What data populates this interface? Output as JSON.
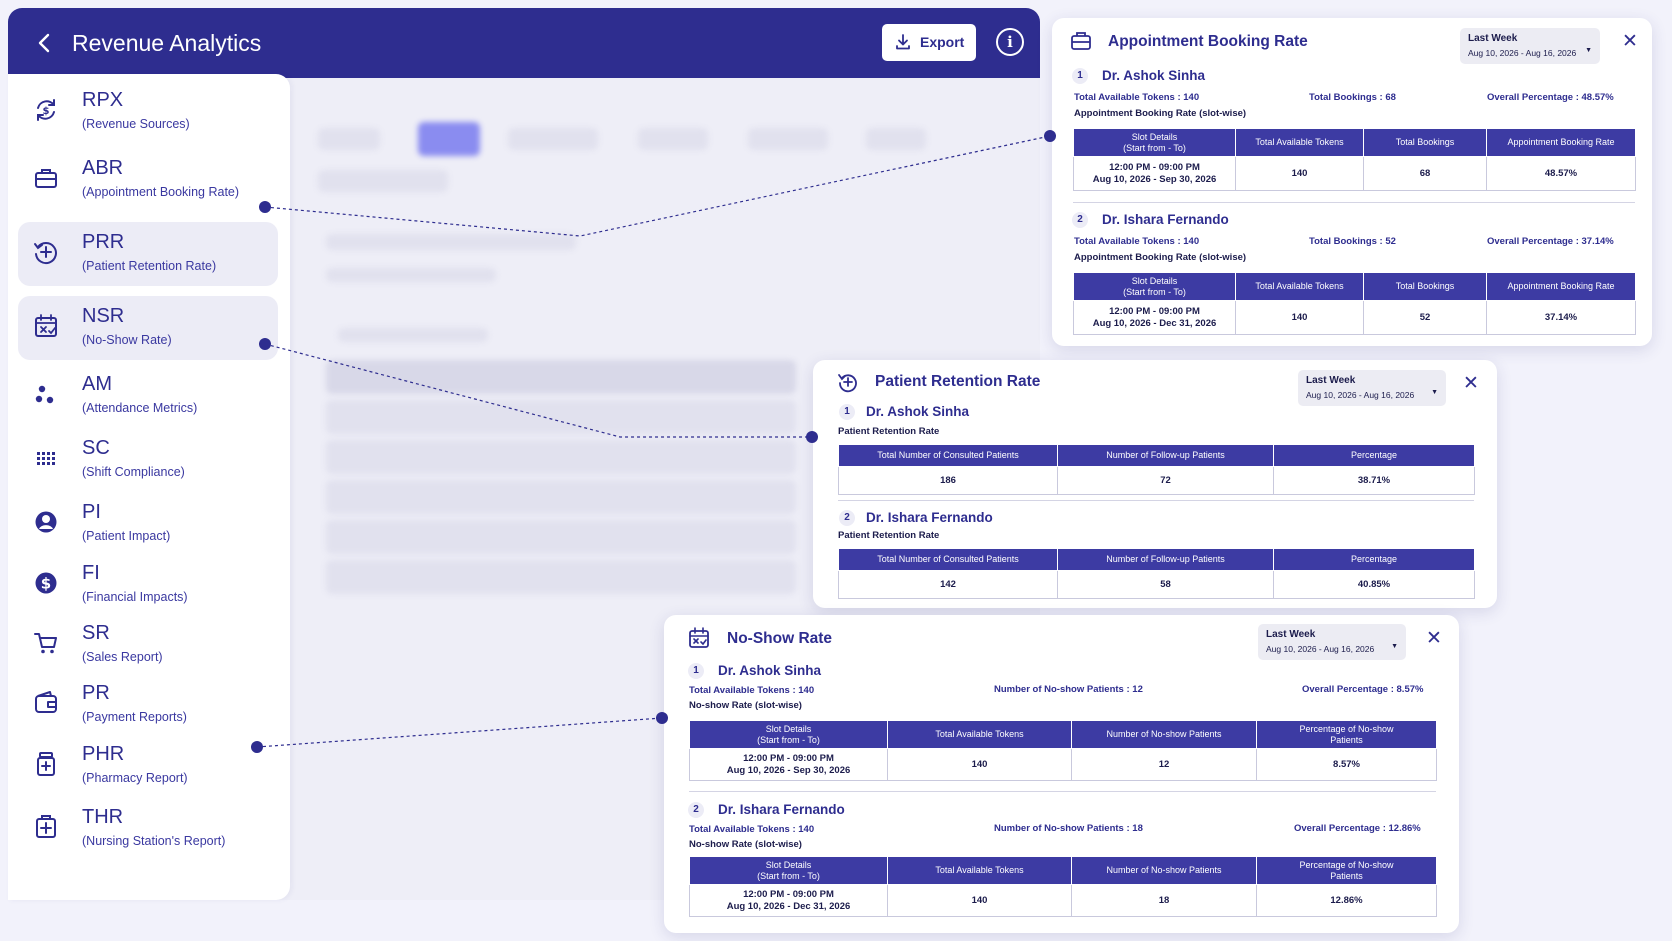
{
  "header": {
    "title": "Revenue Analytics",
    "export_label": "Export"
  },
  "sidebar": {
    "items": [
      {
        "abbr": "RPX",
        "full": "(Revenue Sources)",
        "icon": "revenue-cycle-icon"
      },
      {
        "abbr": "ABR",
        "full": "(Appointment Booking Rate)",
        "icon": "briefcase-icon"
      },
      {
        "abbr": "PRR",
        "full": "(Patient Retention Rate)",
        "icon": "retention-icon"
      },
      {
        "abbr": "NSR",
        "full": "(No-Show Rate)",
        "icon": "calendar-x-icon"
      },
      {
        "abbr": "AM",
        "full": "(Attendance Metrics)",
        "icon": "dots-icon"
      },
      {
        "abbr": "SC",
        "full": "(Shift Compliance)",
        "icon": "grid-icon"
      },
      {
        "abbr": "PI",
        "full": "(Patient Impact)",
        "icon": "user-icon"
      },
      {
        "abbr": "FI",
        "full": "(Financial Impacts)",
        "icon": "dollar-icon"
      },
      {
        "abbr": "SR",
        "full": "(Sales Report)",
        "icon": "cart-icon"
      },
      {
        "abbr": "PR",
        "full": "(Payment Reports)",
        "icon": "wallet-icon"
      },
      {
        "abbr": "PHR",
        "full": "(Pharmacy Report)",
        "icon": "pill-bottle-icon"
      },
      {
        "abbr": "THR",
        "full": "(Nursing Station's Report)",
        "icon": "medical-plus-icon"
      }
    ]
  },
  "abr": {
    "title": "Appointment Booking Rate",
    "range_label": "Last Week",
    "range_dates": "Aug 10, 2026 - Aug 16, 2026",
    "headers": [
      "Slot Details\n(Start from - To)",
      "Total Available Tokens",
      "Total Bookings",
      "Appointment Booking Rate"
    ],
    "doctors": [
      {
        "num": "1",
        "name": "Dr. Ashok Sinha",
        "tokens": "Total Available Tokens : 140",
        "bookings": "Total Bookings : 68",
        "overall": "Overall Percentage : 48.57%",
        "sub": "Appointment Booking Rate (slot-wise)",
        "slot_time": "12:00 PM - 09:00 PM",
        "slot_dates": "Aug 10, 2026 - Sep 30, 2026",
        "v_tokens": "140",
        "v_bookings": "68",
        "v_rate": "48.57%"
      },
      {
        "num": "2",
        "name": "Dr. Ishara Fernando",
        "tokens": "Total Available Tokens : 140",
        "bookings": "Total Bookings : 52",
        "overall": "Overall Percentage : 37.14%",
        "sub": "Appointment Booking Rate (slot-wise)",
        "slot_time": "12:00 PM - 09:00 PM",
        "slot_dates": "Aug 10, 2026 - Dec 31, 2026",
        "v_tokens": "140",
        "v_bookings": "52",
        "v_rate": "37.14%"
      }
    ]
  },
  "prr": {
    "title": "Patient Retention Rate",
    "range_label": "Last Week",
    "range_dates": "Aug 10, 2026 - Aug 16, 2026",
    "headers": [
      "Total Number of Consulted Patients",
      "Number of Follow-up Patients",
      "Percentage"
    ],
    "doctors": [
      {
        "num": "1",
        "name": "Dr. Ashok Sinha",
        "sub": "Patient Retention Rate",
        "v1": "186",
        "v2": "72",
        "v3": "38.71%"
      },
      {
        "num": "2",
        "name": "Dr. Ishara Fernando",
        "sub": "Patient Retention Rate",
        "v1": "142",
        "v2": "58",
        "v3": "40.85%"
      }
    ]
  },
  "nsr": {
    "title": "No-Show Rate",
    "range_label": "Last Week",
    "range_dates": "Aug 10, 2026 - Aug 16, 2026",
    "headers": [
      "Slot Details\n(Start from - To)",
      "Total Available Tokens",
      "Number of No-show Patients",
      "Percentage of No-show\nPatients"
    ],
    "doctors": [
      {
        "num": "1",
        "name": "Dr. Ashok Sinha",
        "tokens": "Total Available Tokens : 140",
        "noshow": "Number of No-show Patients : 12",
        "overall": "Overall Percentage : 8.57%",
        "sub": "No-show Rate (slot-wise)",
        "slot_time": "12:00 PM - 09:00 PM",
        "slot_dates": "Aug 10, 2026 - Sep 30, 2026",
        "v_tokens": "140",
        "v_noshow": "12",
        "v_pct": "8.57%"
      },
      {
        "num": "2",
        "name": "Dr. Ishara Fernando",
        "tokens": "Total Available Tokens : 140",
        "noshow": "Number of No-show Patients : 18",
        "overall": "Overall Percentage : 12.86%",
        "sub": "No-show Rate (slot-wise)",
        "slot_time": "12:00 PM - 09:00 PM",
        "slot_dates": "Aug 10, 2026 - Dec 31, 2026",
        "v_tokens": "140",
        "v_noshow": "18",
        "v_pct": "12.86%"
      }
    ]
  },
  "colors": {
    "primary": "#2e2d8f",
    "table_header": "#3d3ba3",
    "background": "#f2f2fb"
  }
}
